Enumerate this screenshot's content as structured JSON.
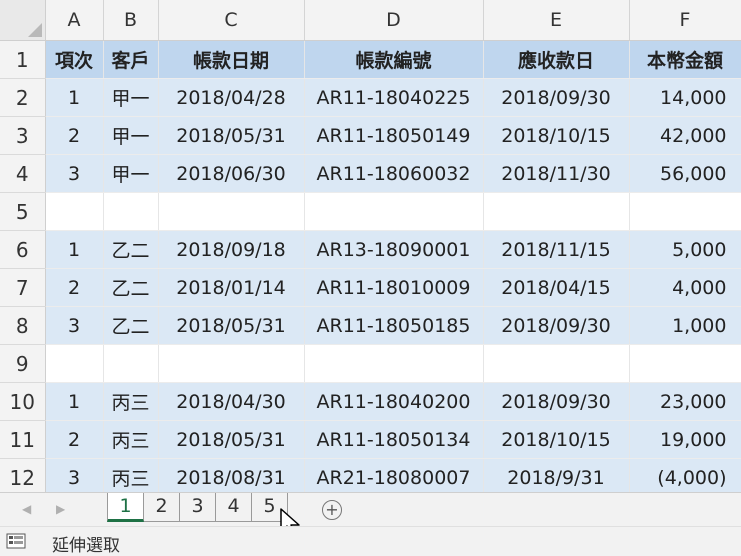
{
  "columns": [
    "A",
    "B",
    "C",
    "D",
    "E",
    "F"
  ],
  "header_row": {
    "num": "1",
    "cells": [
      "項次",
      "客戶",
      "帳款日期",
      "帳款編號",
      "應收款日",
      "本幣金額"
    ]
  },
  "rows": [
    {
      "num": "2",
      "cells": [
        "1",
        "甲一",
        "2018/04/28",
        "AR11-18040225",
        "2018/09/30",
        "14,000"
      ]
    },
    {
      "num": "3",
      "cells": [
        "2",
        "甲一",
        "2018/05/31",
        "AR11-18050149",
        "2018/10/15",
        "42,000"
      ]
    },
    {
      "num": "4",
      "cells": [
        "3",
        "甲一",
        "2018/06/30",
        "AR11-18060032",
        "2018/11/30",
        "56,000"
      ]
    },
    {
      "num": "5",
      "cells": [
        "",
        "",
        "",
        "",
        "",
        ""
      ]
    },
    {
      "num": "6",
      "cells": [
        "1",
        "乙二",
        "2018/09/18",
        "AR13-18090001",
        "2018/11/15",
        "5,000"
      ]
    },
    {
      "num": "7",
      "cells": [
        "2",
        "乙二",
        "2018/01/14",
        "AR11-18010009",
        "2018/04/15",
        "4,000"
      ]
    },
    {
      "num": "8",
      "cells": [
        "3",
        "乙二",
        "2018/05/31",
        "AR11-18050185",
        "2018/09/30",
        "1,000"
      ]
    },
    {
      "num": "9",
      "cells": [
        "",
        "",
        "",
        "",
        "",
        ""
      ]
    },
    {
      "num": "10",
      "cells": [
        "1",
        "丙三",
        "2018/04/30",
        "AR11-18040200",
        "2018/09/30",
        "23,000"
      ]
    },
    {
      "num": "11",
      "cells": [
        "2",
        "丙三",
        "2018/05/31",
        "AR11-18050134",
        "2018/10/15",
        "19,000"
      ]
    },
    {
      "num": "12",
      "cells": [
        "3",
        "丙三",
        "2018/08/31",
        "AR21-18080007",
        "2018/9/31",
        "(4,000)"
      ]
    }
  ],
  "sheet_tabs": [
    "1",
    "2",
    "3",
    "4",
    "5"
  ],
  "active_tab": "1",
  "add_sheet_symbol": "+",
  "status_text": "延伸選取",
  "colors": {
    "header_band": "#bfd6ee",
    "row_band": "#dbe8f5",
    "active_tab": "#1e7145"
  }
}
